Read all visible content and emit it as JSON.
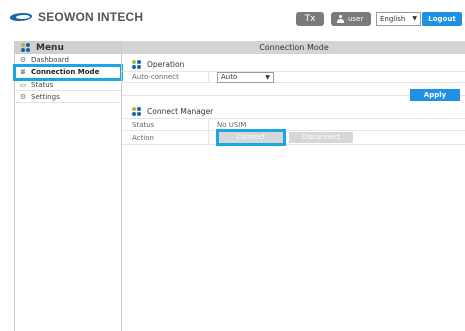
{
  "header": {
    "brand": "SEOWON INTECH",
    "tx_label": "Tx",
    "user_label": "user",
    "language": "English",
    "logout_label": "Logout"
  },
  "sidebar": {
    "title": "Menu",
    "items": [
      {
        "label": "Dashboard",
        "icon": "dashboard-icon"
      },
      {
        "label": "Connection Mode",
        "icon": "antenna-icon",
        "active": true
      },
      {
        "label": "Status",
        "icon": "monitor-icon"
      },
      {
        "label": "Settings",
        "icon": "gear-icon"
      }
    ]
  },
  "main": {
    "title": "Connection Mode",
    "operation": {
      "title": "Operation",
      "auto_connect_label": "Auto-connect",
      "auto_connect_value": "Auto",
      "apply_label": "Apply"
    },
    "manager": {
      "title": "Connect Manager",
      "status_label": "Status",
      "status_value": "No USIM",
      "action_label": "Action",
      "connect_label": "Connect",
      "disconnect_label": "Disconnect"
    }
  },
  "colors": {
    "accent": "#1e90e6",
    "highlight": "#1aa6e0",
    "brand": "#1b64a8"
  }
}
